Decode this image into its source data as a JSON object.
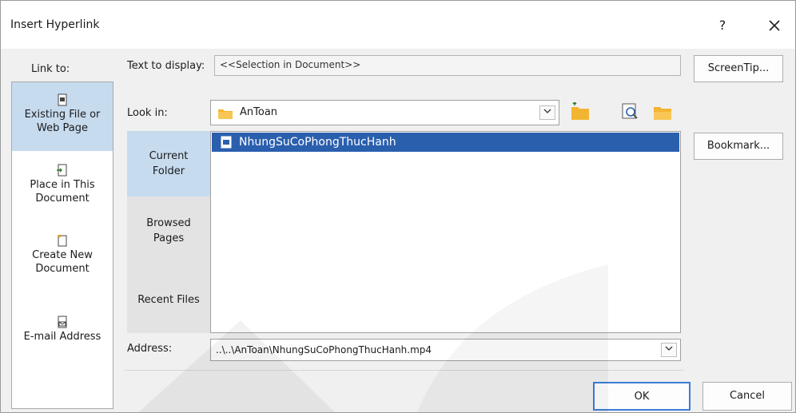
{
  "dialog": {
    "title": "Insert Hyperlink",
    "help_label": "?",
    "close_icon": "close-icon"
  },
  "link_to": {
    "label": "Link to:",
    "items": [
      {
        "label_line1": "Existing File or",
        "label_line2": "Web Page",
        "icon": "existing-file-icon",
        "selected": true
      },
      {
        "label_line1": "Place in This",
        "label_line2": "Document",
        "icon": "place-in-document-icon",
        "selected": false
      },
      {
        "label_line1": "Create New",
        "label_line2": "Document",
        "icon": "new-document-icon",
        "selected": false
      },
      {
        "label_line1": "E-mail Address",
        "label_line2": "",
        "icon": "email-address-icon",
        "selected": false
      }
    ]
  },
  "text_to_display": {
    "label": "Text to display:",
    "value": "<<Selection in Document>>"
  },
  "screentip_label": "ScreenTip...",
  "look_in": {
    "label": "Look in:",
    "value": "AnToan"
  },
  "toolbar_icons": [
    "browse-web-icon",
    "browse-file-icon"
  ],
  "places": [
    {
      "line1": "Current",
      "line2": "Folder",
      "selected": true
    },
    {
      "line1": "Browsed",
      "line2": "Pages",
      "selected": false
    },
    {
      "line1": "Recent Files",
      "line2": "",
      "selected": false
    }
  ],
  "files": [
    {
      "name": "NhungSuCoPhongThucHanh",
      "selected": true,
      "icon": "video-file-icon"
    }
  ],
  "bookmark_label": "Bookmark...",
  "address": {
    "label": "Address:",
    "value": "..\\..\\AnToan\\NhungSuCoPhongThucHanh.mp4"
  },
  "ok_label": "OK",
  "cancel_label": "Cancel",
  "colors": {
    "selection_blue": "#2a5fae",
    "selected_panel": "#c7dbef",
    "folder_yellow": "#f2b531",
    "ok_border": "#3b7dd8"
  }
}
